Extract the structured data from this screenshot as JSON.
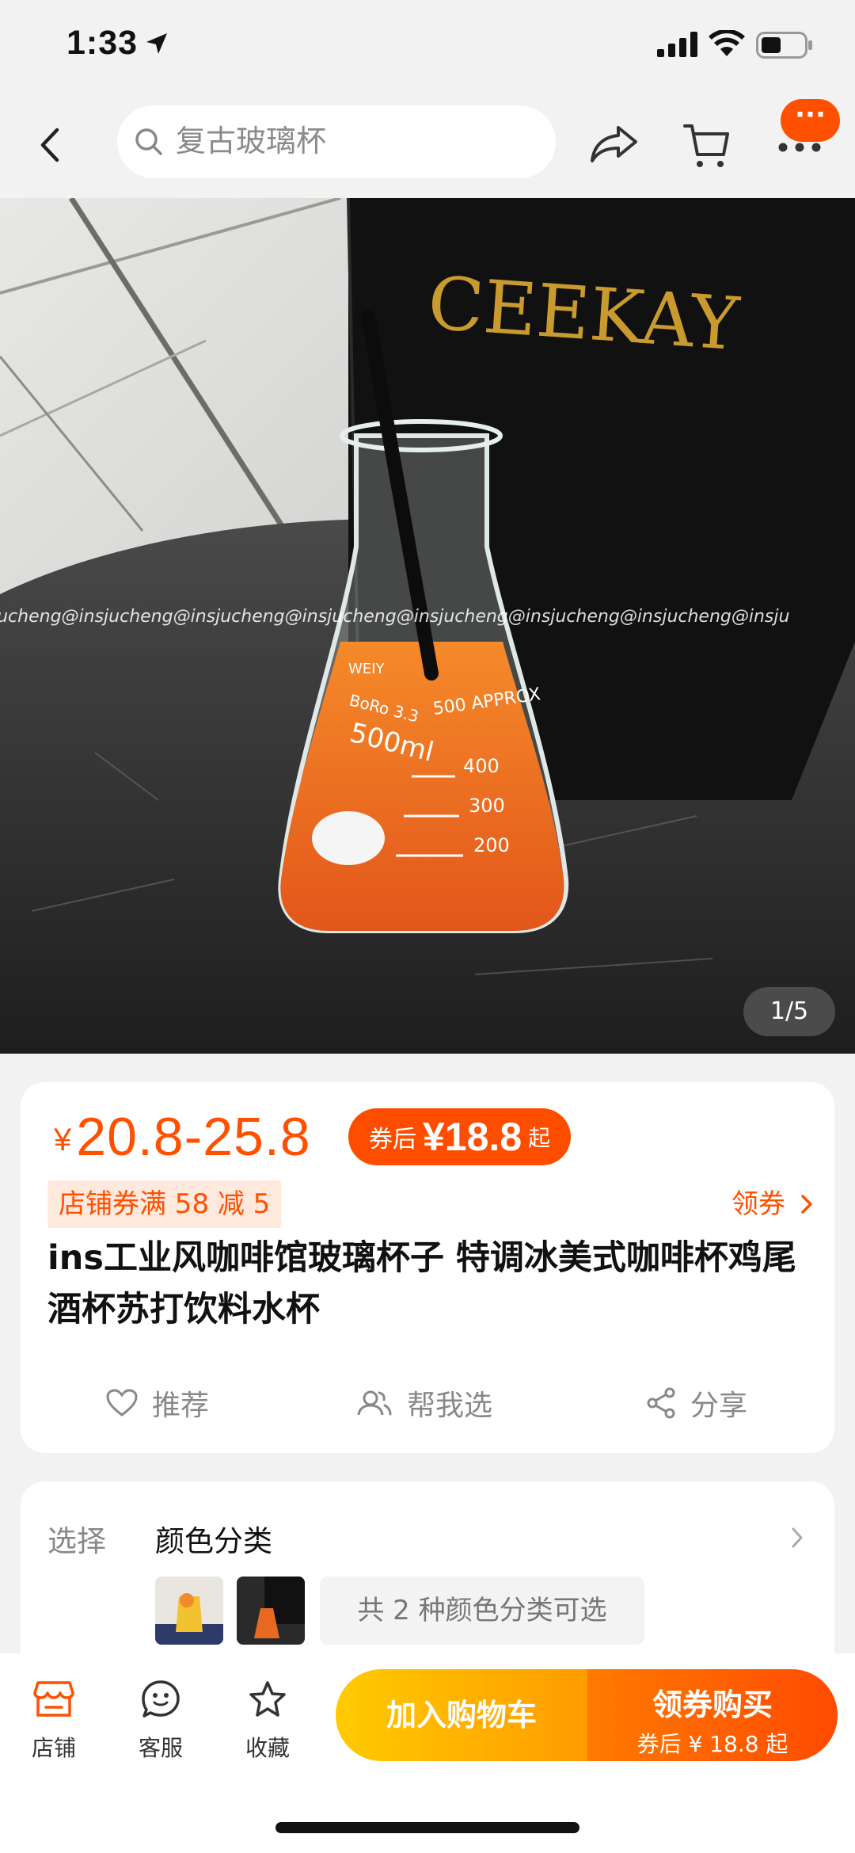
{
  "status_bar": {
    "time": "1:33"
  },
  "nav": {
    "search_placeholder": "复古玻璃杯",
    "message_badge": "···"
  },
  "hero": {
    "page_indicator": "1/5",
    "brand_text": "CEEKAY",
    "watermark": "jucheng@insjucheng@insjucheng@insjucheng@insjucheng@insjucheng@insjucheng@insju",
    "flask_text": {
      "brand": "WEIY",
      "glass": "BoRo 3.3",
      "volume": "500ml",
      "approx": "500 APPROX",
      "mark_400": "400",
      "mark_300": "300",
      "mark_200": "200"
    }
  },
  "price": {
    "currency": "¥",
    "range": "20.8-25.8",
    "after_coupon_label": "券后",
    "after_coupon_value": "¥18.8",
    "after_coupon_suffix": "起",
    "store_coupon": "店铺券满 58 减 5",
    "get_coupon": "领券"
  },
  "product": {
    "title": "ins工业风咖啡馆玻璃杯子 特调冰美式咖啡杯鸡尾酒杯苏打饮料水杯"
  },
  "actions": [
    {
      "label": "推荐",
      "icon": "heart-icon"
    },
    {
      "label": "帮我选",
      "icon": "people-icon"
    },
    {
      "label": "分享",
      "icon": "share-icon"
    }
  ],
  "select": {
    "label": "选择",
    "title": "颜色分类",
    "options_text": "共 2 种颜色分类可选"
  },
  "bottom_bar": {
    "tabs": [
      {
        "label": "店铺",
        "icon": "store-icon"
      },
      {
        "label": "客服",
        "icon": "service-icon"
      },
      {
        "label": "收藏",
        "icon": "star-icon"
      }
    ],
    "add_to_cart": "加入购物车",
    "buy_label": "领券购买",
    "buy_sub": "券后 ¥ 18.8 起"
  },
  "colors": {
    "accent": "#ff5000",
    "cart_btn": "#ffb400",
    "buy_btn": "#ff5a00"
  }
}
